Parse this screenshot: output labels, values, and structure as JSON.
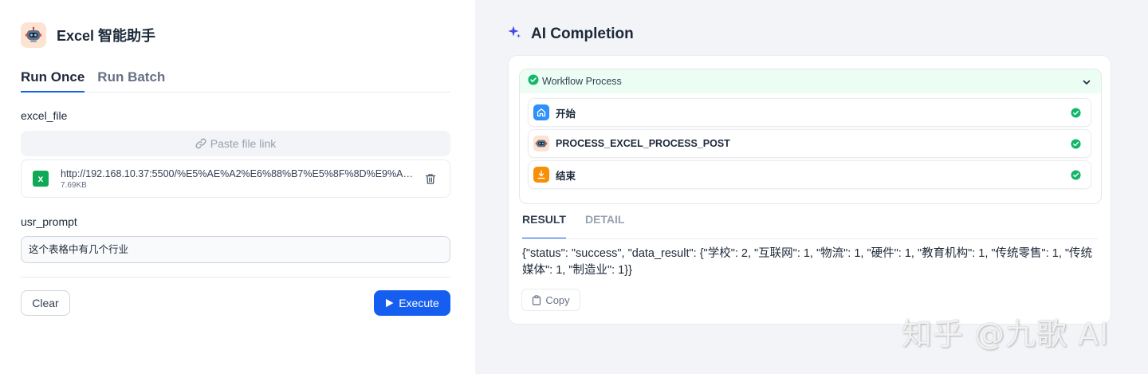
{
  "app": {
    "title": "Excel 智能助手",
    "logo_icon": "robot-icon"
  },
  "tabs": [
    {
      "label": "Run Once",
      "active": true
    },
    {
      "label": "Run Batch",
      "active": false
    }
  ],
  "form": {
    "excel_file": {
      "label": "excel_file",
      "paste_placeholder": "Paste file link",
      "file": {
        "name": "http://192.168.10.37:5500/%E5%AE%A2%E6%88%B7%E5%8F%8D%E9%A6...",
        "size": "7.69KB",
        "icon": "excel-file-icon"
      }
    },
    "usr_prompt": {
      "label": "usr_prompt",
      "value": "这个表格中有几个行业"
    },
    "buttons": {
      "clear": "Clear",
      "execute": "Execute"
    }
  },
  "completion": {
    "title": "AI Completion",
    "workflow": {
      "label": "Workflow Process",
      "status": "success",
      "nodes": [
        {
          "label": "开始",
          "icon": "home-icon",
          "color": "#2e90fa",
          "status": "success"
        },
        {
          "label": "PROCESS_EXCEL_PROCESS_POST",
          "icon": "robot-icon",
          "color": "#fde3d1",
          "status": "success"
        },
        {
          "label": "结束",
          "icon": "flag-icon",
          "color": "#f79009",
          "status": "success"
        }
      ]
    },
    "result_tabs": [
      {
        "label": "RESULT",
        "active": true
      },
      {
        "label": "DETAIL",
        "active": false
      }
    ],
    "result_text": "{\"status\": \"success\", \"data_result\": {\"学校\": 2, \"互联网\": 1, \"物流\": 1, \"硬件\": 1, \"教育机构\": 1, \"传统零售\": 1, \"传统媒体\": 1, \"制造业\": 1}}",
    "copy_label": "Copy"
  },
  "watermark": "知乎 @九歌 AI",
  "colors": {
    "primary": "#155eef",
    "success": "#12b76a",
    "excel_green": "#0fa958"
  }
}
